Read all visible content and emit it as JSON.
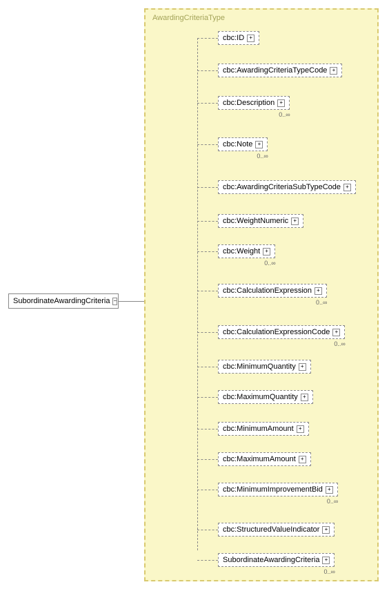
{
  "root": {
    "label": "SubordinateAwardingCriteria"
  },
  "group_title": "AwardingCriteriaType",
  "nodes": [
    {
      "label": "cbc:ID",
      "card": ""
    },
    {
      "label": "cbc:AwardingCriteriaTypeCode",
      "card": ""
    },
    {
      "label": "cbc:Description",
      "card": "0..∞"
    },
    {
      "label": "cbc:Note",
      "card": "0..∞"
    },
    {
      "label": "cbc:AwardingCriteriaSubTypeCode",
      "card": ""
    },
    {
      "label": "cbc:WeightNumeric",
      "card": ""
    },
    {
      "label": "cbc:Weight",
      "card": "0..∞"
    },
    {
      "label": "cbc:CalculationExpression",
      "card": "0..∞"
    },
    {
      "label": "cbc:CalculationExpressionCode",
      "card": "0..∞"
    },
    {
      "label": "cbc:MinimumQuantity",
      "card": ""
    },
    {
      "label": "cbc:MaximumQuantity",
      "card": ""
    },
    {
      "label": "cbc:MinimumAmount",
      "card": ""
    },
    {
      "label": "cbc:MaximumAmount",
      "card": ""
    },
    {
      "label": "cbc:MinimumImprovementBid",
      "card": "0..∞"
    },
    {
      "label": "cbc:StructuredValueIndicator",
      "card": ""
    },
    {
      "label": "SubordinateAwardingCriteria",
      "card": "0..∞"
    }
  ],
  "chart_data": {
    "type": "tree",
    "root": "SubordinateAwardingCriteria",
    "complex_type": "AwardingCriteriaType",
    "compositor": "sequence",
    "children": [
      {
        "name": "cbc:ID",
        "min": 0,
        "max": 1
      },
      {
        "name": "cbc:AwardingCriteriaTypeCode",
        "min": 0,
        "max": 1
      },
      {
        "name": "cbc:Description",
        "min": 0,
        "max": "unbounded"
      },
      {
        "name": "cbc:Note",
        "min": 0,
        "max": "unbounded"
      },
      {
        "name": "cbc:AwardingCriteriaSubTypeCode",
        "min": 0,
        "max": 1
      },
      {
        "name": "cbc:WeightNumeric",
        "min": 0,
        "max": 1
      },
      {
        "name": "cbc:Weight",
        "min": 0,
        "max": "unbounded"
      },
      {
        "name": "cbc:CalculationExpression",
        "min": 0,
        "max": "unbounded"
      },
      {
        "name": "cbc:CalculationExpressionCode",
        "min": 0,
        "max": "unbounded"
      },
      {
        "name": "cbc:MinimumQuantity",
        "min": 0,
        "max": 1
      },
      {
        "name": "cbc:MaximumQuantity",
        "min": 0,
        "max": 1
      },
      {
        "name": "cbc:MinimumAmount",
        "min": 0,
        "max": 1
      },
      {
        "name": "cbc:MaximumAmount",
        "min": 0,
        "max": 1
      },
      {
        "name": "cbc:MinimumImprovementBid",
        "min": 0,
        "max": "unbounded"
      },
      {
        "name": "cbc:StructuredValueIndicator",
        "min": 0,
        "max": 1
      },
      {
        "name": "SubordinateAwardingCriteria",
        "min": 0,
        "max": "unbounded"
      }
    ]
  }
}
